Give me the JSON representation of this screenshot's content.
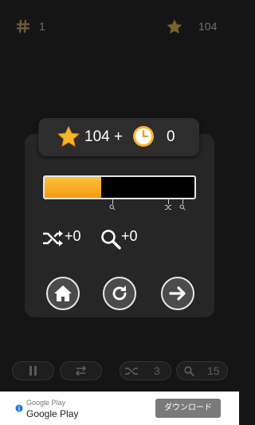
{
  "top_bar": {
    "level": "1",
    "score": "104"
  },
  "summary": {
    "score": "104",
    "plus": "+",
    "time": "0"
  },
  "progress": {
    "fraction": 0.38
  },
  "boosts": {
    "shuffle": "+0",
    "hint": "+0"
  },
  "toolbar": {
    "shuffle_count": "3",
    "hint_count": "15"
  },
  "ad": {
    "source": "Google Play",
    "title": "Google Play",
    "button": "ダウンロード"
  },
  "colors": {
    "accent": "#f7b52a",
    "background": "#151515",
    "panel": "#262626"
  },
  "icons": [
    "hash-icon",
    "star-icon",
    "clock-icon",
    "shuffle-icon",
    "magnifier-icon",
    "home-icon",
    "restart-icon",
    "arrow-right-icon",
    "pause-icon",
    "swap-icon",
    "info-icon"
  ]
}
